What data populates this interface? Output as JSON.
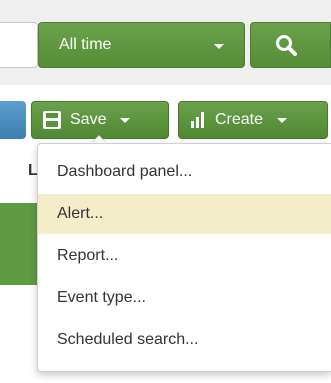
{
  "search": {
    "time_range_label": "All time"
  },
  "toolbar": {
    "save_label": "Save",
    "create_label": "Create"
  },
  "background": {
    "partial_letter": "L"
  },
  "create_menu": {
    "items": [
      {
        "label": "Dashboard panel...",
        "highlighted": false
      },
      {
        "label": "Alert...",
        "highlighted": true
      },
      {
        "label": "Report...",
        "highlighted": false
      },
      {
        "label": "Event type...",
        "highlighted": false
      },
      {
        "label": "Scheduled search...",
        "highlighted": false
      }
    ]
  },
  "colors": {
    "primary_green": "#5f9b42",
    "highlight": "#f3edca",
    "accent_blue": "#3c7fb0"
  }
}
